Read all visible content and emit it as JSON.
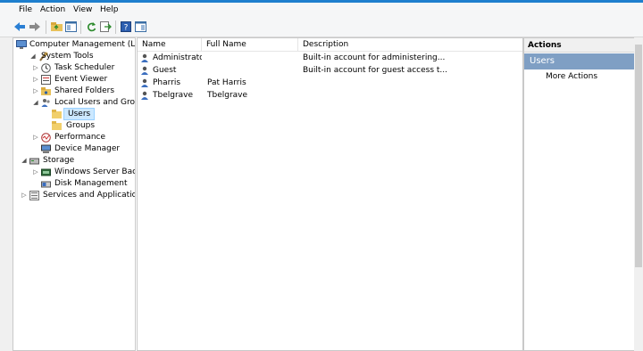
{
  "menu": {
    "file": "File",
    "action": "Action",
    "view": "View",
    "help": "Help"
  },
  "toolbar_icons": [
    "back-arrow-icon",
    "forward-arrow-icon",
    "up-folder-icon",
    "console-tree-icon",
    "refresh-icon",
    "export-list-icon",
    "help-icon",
    "show-hide-action-pane-icon"
  ],
  "tree": {
    "root": "Computer Management (Local",
    "system_tools": "System Tools",
    "task_scheduler": "Task Scheduler",
    "event_viewer": "Event Viewer",
    "shared_folders": "Shared Folders",
    "local_users_groups": "Local Users and Groups",
    "users": "Users",
    "groups": "Groups",
    "performance": "Performance",
    "device_manager": "Device Manager",
    "storage": "Storage",
    "windows_server_backup": "Windows Server Backup",
    "disk_management": "Disk Management",
    "services_apps": "Services and Applications"
  },
  "list": {
    "columns": {
      "name": "Name",
      "full_name": "Full Name",
      "description": "Description"
    },
    "rows": [
      {
        "name": "Administrator",
        "full_name": "",
        "description": "Built-in account for administering..."
      },
      {
        "name": "Guest",
        "full_name": "",
        "description": "Built-in account for guest access t..."
      },
      {
        "name": "Pharris",
        "full_name": "Pat Harris",
        "description": ""
      },
      {
        "name": "Tbelgrave",
        "full_name": "Tbelgrave",
        "description": ""
      }
    ]
  },
  "actions": {
    "header": "Actions",
    "section": "Users",
    "more": "More Actions"
  },
  "colors": {
    "accent": "#1e7fce",
    "selection": "#cce8ff",
    "action_section": "#7f9fc4"
  }
}
